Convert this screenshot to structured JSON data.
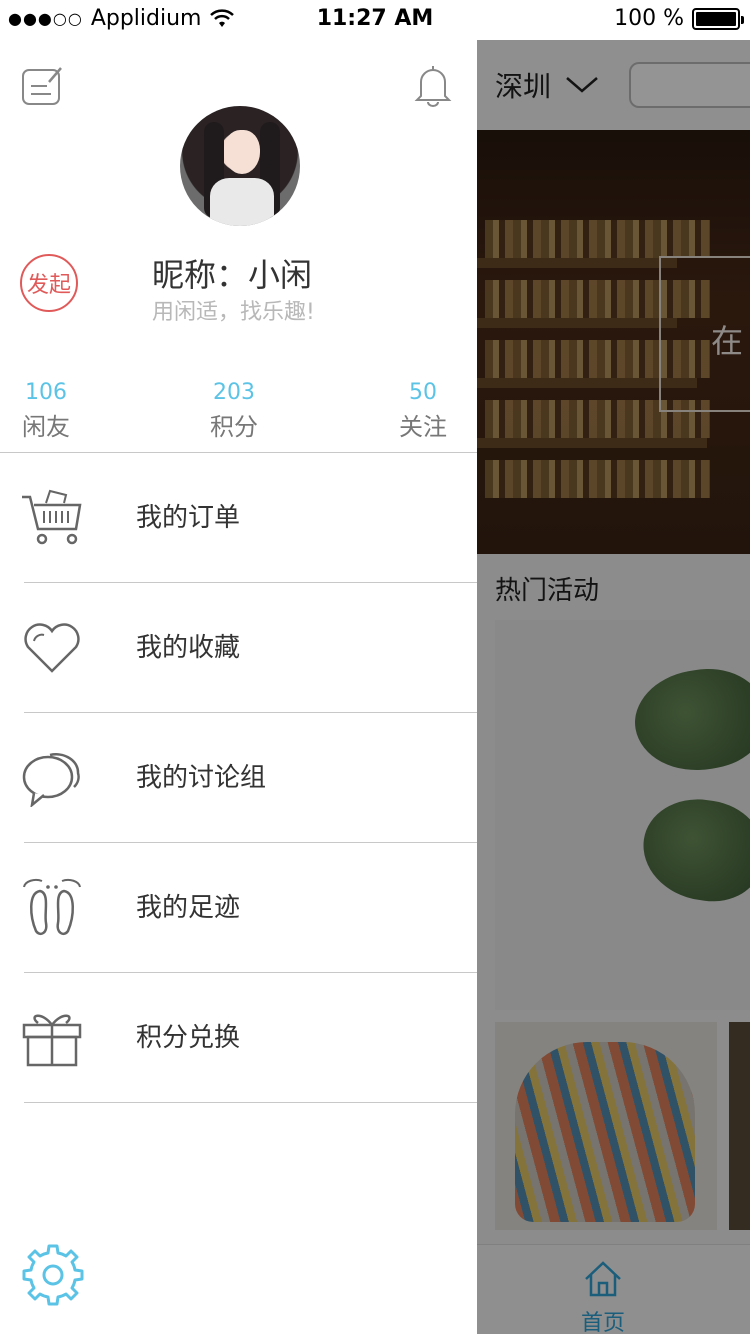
{
  "status_bar": {
    "carrier": "Applidium",
    "time": "11:27 AM",
    "battery": "100 %"
  },
  "drawer": {
    "profile": {
      "nickname": "昵称：小闲",
      "tagline": "用闲适，找乐趣!",
      "initiate_badge": "发起"
    },
    "stats": [
      {
        "value": "106",
        "label": "闲友"
      },
      {
        "value": "203",
        "label": "积分"
      },
      {
        "value": "50",
        "label": "关注"
      }
    ],
    "menu": [
      {
        "label": "我的订单",
        "icon": "cart-icon"
      },
      {
        "label": "我的收藏",
        "icon": "heart-icon"
      },
      {
        "label": "我的讨论组",
        "icon": "chat-bubbles-icon"
      },
      {
        "label": "我的足迹",
        "icon": "footprints-icon"
      },
      {
        "label": "积分兑换",
        "icon": "gift-icon"
      }
    ]
  },
  "main_page": {
    "city": "深圳",
    "banner_text": "在",
    "section_title": "热门活动",
    "tab_home_label": "首页"
  },
  "colors": {
    "accent_blue": "#5bc3e6",
    "badge_red": "#e05a5a",
    "overlay": "rgba(0,0,0,0.42)"
  }
}
